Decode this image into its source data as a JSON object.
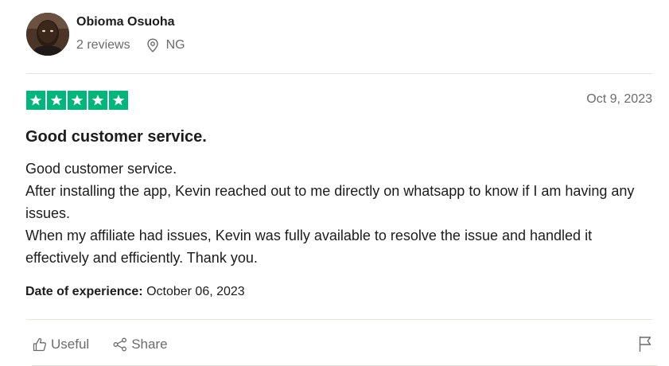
{
  "reviewer": {
    "name": "Obioma Osuoha",
    "reviews_count": "2 reviews",
    "location": "NG",
    "avatar_icon": "person-avatar"
  },
  "review": {
    "rating": 5,
    "rating_max": 5,
    "star_color": "#00b67a",
    "date": "Oct 9, 2023",
    "title": "Good customer service.",
    "body": [
      "Good customer service.",
      "After installing the app, Kevin reached out to me directly on whatsapp to know if I am having any issues.",
      "When my affiliate had issues, Kevin was fully available to resolve the issue and handled it effectively and efficiently. Thank you."
    ],
    "experience_label": "Date of experience:",
    "experience_date": "October 06, 2023"
  },
  "actions": {
    "useful_label": "Useful",
    "share_label": "Share",
    "useful_icon": "thumbs-up-icon",
    "share_icon": "share-icon",
    "report_icon": "flag-icon"
  }
}
